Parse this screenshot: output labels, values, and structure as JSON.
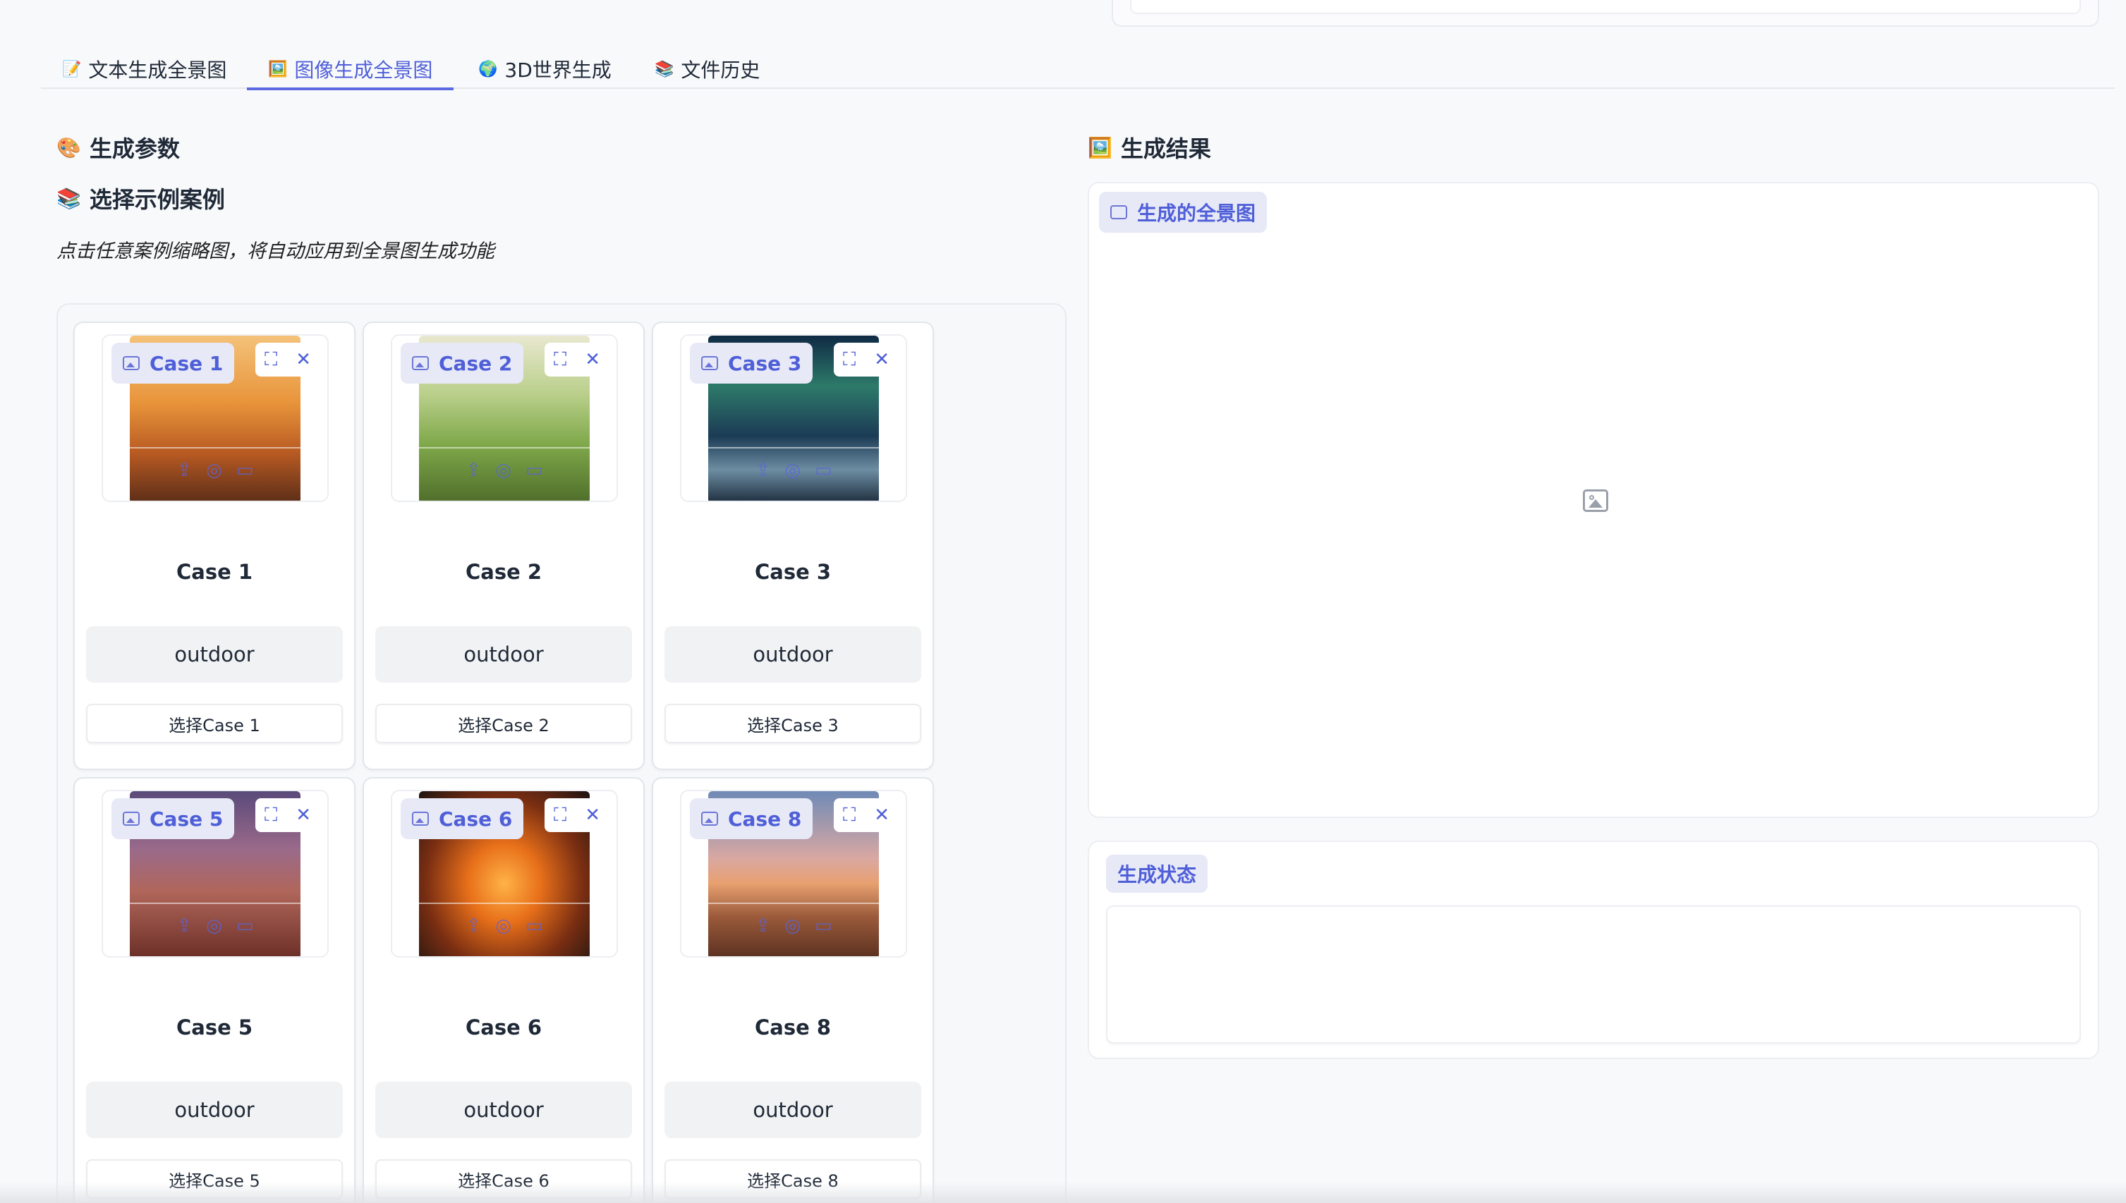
{
  "tabs": [
    {
      "label": "文本生成全景图",
      "icon": "📝",
      "active": false
    },
    {
      "label": "图像生成全景图",
      "icon": "🖼️",
      "active": true
    },
    {
      "label": "3D世界生成",
      "icon": "🌍",
      "active": false
    },
    {
      "label": "文件历史",
      "icon": "📚",
      "active": false
    }
  ],
  "params": {
    "title": "生成参数",
    "icon": "🎨"
  },
  "examples": {
    "title": "选择示例案例",
    "icon": "📚",
    "hint": "点击任意案例缩略图，将自动应用到全景图生成功能"
  },
  "cards": [
    {
      "image_label": "Case 1",
      "title": "Case 1",
      "tag": "outdoor",
      "button": "选择Case 1"
    },
    {
      "image_label": "Case 2",
      "title": "Case 2",
      "tag": "outdoor",
      "button": "选择Case 2"
    },
    {
      "image_label": "Case 3",
      "title": "Case 3",
      "tag": "outdoor",
      "button": "选择Case 3"
    },
    {
      "image_label": "Case 5",
      "title": "Case 5",
      "tag": "outdoor",
      "button": "选择Case 5"
    },
    {
      "image_label": "Case 6",
      "title": "Case 6",
      "tag": "outdoor",
      "button": "选择Case 6"
    },
    {
      "image_label": "Case 8",
      "title": "Case 8",
      "tag": "outdoor",
      "button": "选择Case 8"
    }
  ],
  "result": {
    "title": "生成结果",
    "icon": "🖼️",
    "panorama_label": "生成的全景图",
    "status_label": "生成状态"
  },
  "colors": {
    "accent": "#4f5fd8",
    "badge_bg": "#e7e9f7"
  }
}
